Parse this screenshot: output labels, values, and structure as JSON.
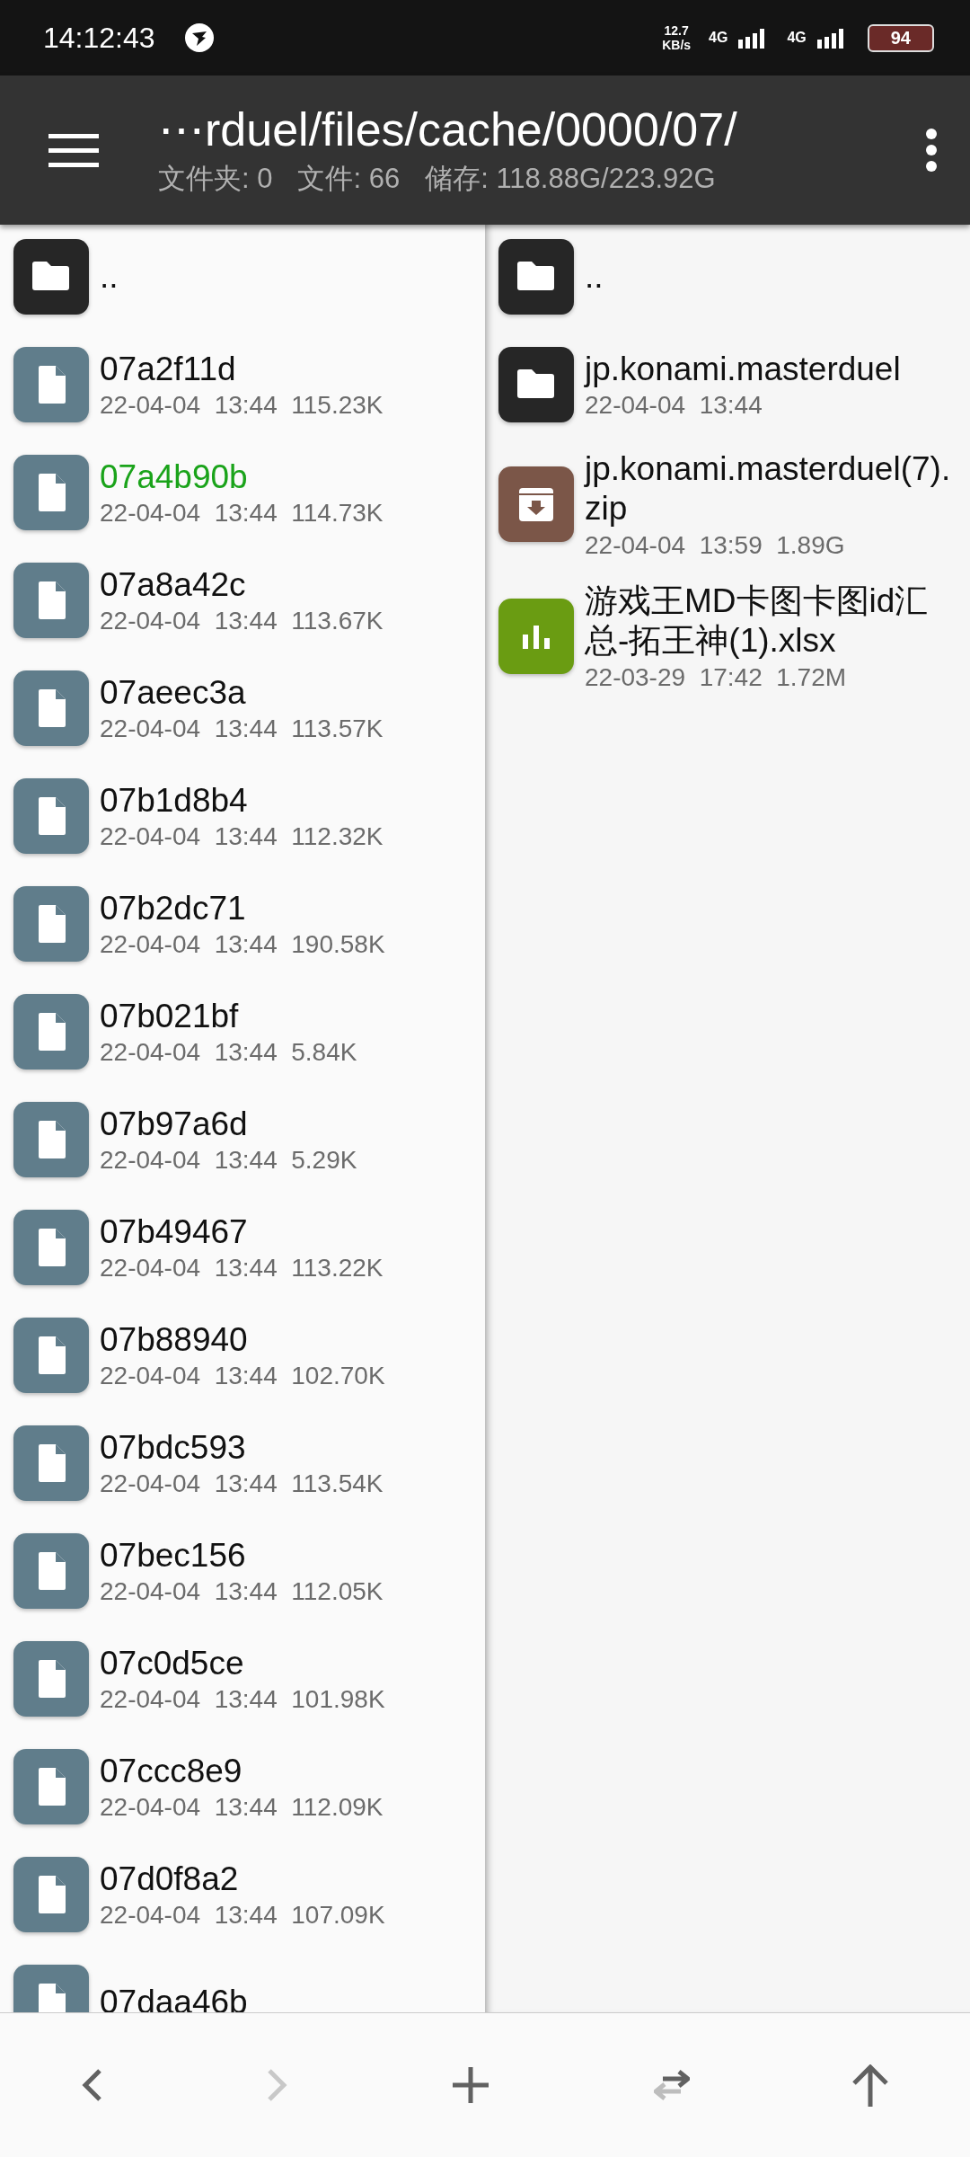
{
  "status_bar": {
    "time": "14:12:43",
    "net_speed": "12.7",
    "net_unit": "KB/s",
    "networks": [
      "4G",
      "4G"
    ],
    "battery": "94"
  },
  "header": {
    "path": "⋯rduel/files/cache/0000/07/",
    "folders_label": "文件夹: 0",
    "files_label": "文件: 66",
    "storage_label": "储存: 118.88G/223.92G"
  },
  "left_pane": {
    "items": [
      {
        "kind": "folder",
        "name": "..",
        "selected": false
      },
      {
        "kind": "file",
        "name": "07a2f11d",
        "meta": "22-04-04  13:44  115.23K",
        "selected": false
      },
      {
        "kind": "file",
        "name": "07a4b90b",
        "meta": "22-04-04  13:44  114.73K",
        "selected": true
      },
      {
        "kind": "file",
        "name": "07a8a42c",
        "meta": "22-04-04  13:44  113.67K",
        "selected": false
      },
      {
        "kind": "file",
        "name": "07aeec3a",
        "meta": "22-04-04  13:44  113.57K",
        "selected": false
      },
      {
        "kind": "file",
        "name": "07b1d8b4",
        "meta": "22-04-04  13:44  112.32K",
        "selected": false
      },
      {
        "kind": "file",
        "name": "07b2dc71",
        "meta": "22-04-04  13:44  190.58K",
        "selected": false
      },
      {
        "kind": "file",
        "name": "07b021bf",
        "meta": "22-04-04  13:44  5.84K",
        "selected": false
      },
      {
        "kind": "file",
        "name": "07b97a6d",
        "meta": "22-04-04  13:44  5.29K",
        "selected": false
      },
      {
        "kind": "file",
        "name": "07b49467",
        "meta": "22-04-04  13:44  113.22K",
        "selected": false
      },
      {
        "kind": "file",
        "name": "07b88940",
        "meta": "22-04-04  13:44  102.70K",
        "selected": false
      },
      {
        "kind": "file",
        "name": "07bdc593",
        "meta": "22-04-04  13:44  113.54K",
        "selected": false
      },
      {
        "kind": "file",
        "name": "07bec156",
        "meta": "22-04-04  13:44  112.05K",
        "selected": false
      },
      {
        "kind": "file",
        "name": "07c0d5ce",
        "meta": "22-04-04  13:44  101.98K",
        "selected": false
      },
      {
        "kind": "file",
        "name": "07ccc8e9",
        "meta": "22-04-04  13:44  112.09K",
        "selected": false
      },
      {
        "kind": "file",
        "name": "07d0f8a2",
        "meta": "22-04-04  13:44  107.09K",
        "selected": false
      },
      {
        "kind": "file",
        "name": "07daa46b",
        "selected": false
      }
    ]
  },
  "right_pane": {
    "items": [
      {
        "kind": "folder",
        "name": "..",
        "selected": false
      },
      {
        "kind": "folder",
        "name": "jp.konami.masterduel",
        "meta": "22-04-04  13:44",
        "selected": false
      },
      {
        "kind": "archive",
        "name": "jp.konami.masterduel(7).zip",
        "meta": "22-04-04  13:59  1.89G",
        "selected": false
      },
      {
        "kind": "spreadsheet",
        "name": "游戏王MD卡图卡图id汇总-拓王神(1).xlsx",
        "meta": "22-03-29  17:42  1.72M",
        "selected": false
      }
    ]
  },
  "toolbar": [
    {
      "kind": "back",
      "disabled": false
    },
    {
      "kind": "forward",
      "disabled": true
    },
    {
      "kind": "add",
      "disabled": false
    },
    {
      "kind": "swap",
      "disabled": false
    },
    {
      "kind": "up",
      "disabled": false
    }
  ]
}
